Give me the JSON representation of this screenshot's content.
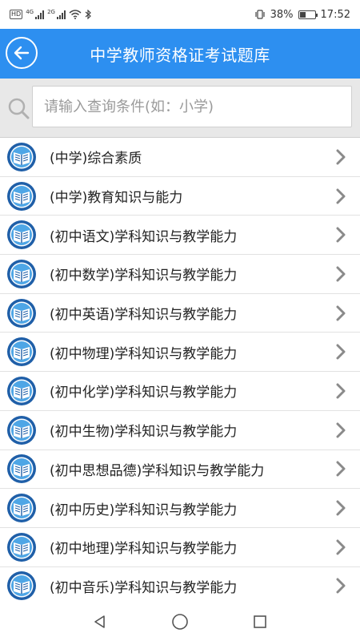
{
  "status_bar": {
    "network_left": "4G",
    "network_right": "2G",
    "battery_percent": "38%",
    "time": "17:52"
  },
  "header": {
    "title": "中学教师资格证考试题库"
  },
  "search": {
    "placeholder": "请输入查询条件(如：小学)",
    "value": ""
  },
  "list": {
    "items": [
      {
        "label": "(中学)综合素质"
      },
      {
        "label": "(中学)教育知识与能力"
      },
      {
        "label": "(初中语文)学科知识与教学能力"
      },
      {
        "label": "(初中数学)学科知识与教学能力"
      },
      {
        "label": "(初中英语)学科知识与教学能力"
      },
      {
        "label": "(初中物理)学科知识与教学能力"
      },
      {
        "label": "(初中化学)学科知识与教学能力"
      },
      {
        "label": "(初中生物)学科知识与教学能力"
      },
      {
        "label": "(初中思想品德)学科知识与教学能力"
      },
      {
        "label": "(初中历史)学科知识与教学能力"
      },
      {
        "label": "(初中地理)学科知识与教学能力"
      },
      {
        "label": "(初中音乐)学科知识与教学能力"
      }
    ]
  },
  "colors": {
    "header_bg": "#2d8ff0",
    "logo_blue": "#1f5fa8",
    "logo_light": "#4ea6e6"
  },
  "icons": {
    "back": "arrow-left-circle-icon",
    "search": "magnifier-icon",
    "item_logo": "book-emblem-icon",
    "chevron": "chevron-right-icon",
    "nav_back": "triangle-back-icon",
    "nav_home": "circle-home-icon",
    "nav_recent": "square-recent-icon"
  }
}
